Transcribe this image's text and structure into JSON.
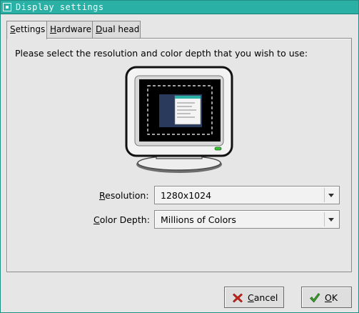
{
  "window": {
    "title": "Display settings",
    "title_bar_color": "#2ab0a4"
  },
  "tabs": [
    {
      "label": "Settings",
      "mnemonic": "S",
      "rest": "ettings",
      "active": true
    },
    {
      "label": "Hardware",
      "mnemonic": "H",
      "rest": "ardware",
      "active": false
    },
    {
      "label": "Dual head",
      "mnemonic": "D",
      "rest": "ual head",
      "active": false
    }
  ],
  "settings": {
    "instruction": "Please select the resolution and color depth that you wish to use:",
    "monitor_icon": "monitor-preview-icon",
    "resolution": {
      "label": "Resolution:",
      "mnemonic": "R",
      "rest": "esolution:",
      "value": "1280x1024"
    },
    "color_depth": {
      "label": "Color Depth:",
      "mnemonic": "C",
      "rest": "olor Depth:",
      "value": "Millions of Colors"
    }
  },
  "buttons": {
    "cancel": {
      "label": "Cancel",
      "mnemonic": "C",
      "rest": "ancel",
      "icon": "cancel-x-icon",
      "icon_color": "#d0241c"
    },
    "ok": {
      "label": "OK",
      "mnemonic": "O",
      "rest": "K",
      "icon": "checkmark-icon",
      "icon_color": "#3a9a2a"
    }
  }
}
